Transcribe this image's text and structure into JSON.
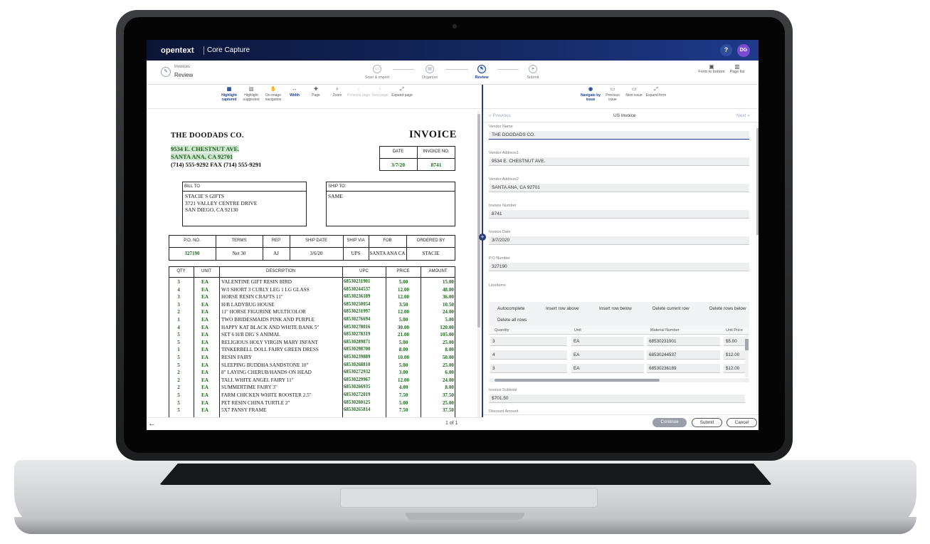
{
  "app": {
    "brand": "opentext",
    "product": "Core Capture",
    "help_glyph": "?",
    "user_initials": "DG"
  },
  "breadcrumb": {
    "parent": "Invoices",
    "current": "Review"
  },
  "steps": [
    {
      "label": "Scan & import",
      "icon": "scan-icon"
    },
    {
      "label": "Organize",
      "icon": "organize-icon"
    },
    {
      "label": "Review",
      "icon": "review-icon",
      "active": true
    },
    {
      "label": "Submit",
      "icon": "submit-icon"
    }
  ],
  "top_tools": {
    "form_to_bottom": "Form to bottom",
    "page_list": "Page list"
  },
  "doc_tools": {
    "highlight_captured": "Highlight captured",
    "highlight_suggested": "Highlight suggested",
    "on_image_navigation": "On-image navigation",
    "width": "Width",
    "page": "Page",
    "zoom": "Zoom",
    "previous_page": "Previous page",
    "next_page": "Next page",
    "expand_page": "Expand page"
  },
  "form_tools": {
    "navigate_by_issue": "Navigate by issue",
    "previous_issue": "Previous issue",
    "next_issue": "Next issue",
    "expand_form": "Expand form"
  },
  "invoice_doc": {
    "company": "THE DOODADS CO.",
    "title": "INVOICE",
    "address1": "9534 E. CHESTNUT AVE.",
    "address2": "SANTA ANA, CA 92701",
    "phone": "(714) 555-9292  FAX (714) 555-9291",
    "date_label": "DATE",
    "invoice_no_label": "INVOICE NO.",
    "date": "3/7/20",
    "invoice_no": "8741",
    "bill_to_label": "BILL TO",
    "bill_to_lines": [
      "STACIE`S GIFTS",
      "3721 VALLEY CENTRE DRIVE",
      "SAN DIEGO, CA  92130"
    ],
    "ship_to_label": "SHIP TO:",
    "ship_to": "SAME",
    "order_headers": [
      "P.O. NO.",
      "TERMS",
      "REP",
      "SHIP DATE",
      "SHIP VIA",
      "FOB",
      "ORDERED BY"
    ],
    "order_values": [
      "327190",
      "Net 30",
      "AJ",
      "3/6/20",
      "UPS",
      "SANTA ANA CA",
      "STACIE"
    ],
    "line_headers": [
      "QTY",
      "UNIT",
      "DESCRIPTION",
      "UPC",
      "PRICE",
      "AMOUNT"
    ],
    "lines": [
      {
        "qty": "3",
        "unit": "EA",
        "desc": "VALENTINE GIFT RESIN BIRD",
        "upc": "68530231901",
        "price": "5.00",
        "amount": "15.00"
      },
      {
        "qty": "4",
        "unit": "EA",
        "desc": "W/I SHORT 3 CURLY LEG 1 LG GLASS",
        "upc": "68530244537",
        "price": "12.00",
        "amount": "48.00"
      },
      {
        "qty": "3",
        "unit": "EA",
        "desc": "HORSE RESIN CRAFTS 11\"",
        "upc": "68530236189",
        "price": "12.00",
        "amount": "36.00"
      },
      {
        "qty": "3",
        "unit": "EA",
        "desc": "H/B LADYBUG HOUSE",
        "upc": "68530250054",
        "price": "3.50",
        "amount": "10.50"
      },
      {
        "qty": "2",
        "unit": "EA",
        "desc": "11\" HORSE FIGURINE MULTICOLOR",
        "upc": "68530231997",
        "price": "12.00",
        "amount": "24.00"
      },
      {
        "qty": "1",
        "unit": "EA",
        "desc": "TWO BRIDESMAIDS PINK AND PURPLE",
        "upc": "68530276694",
        "price": "5.00",
        "amount": "5.00"
      },
      {
        "qty": "4",
        "unit": "EA",
        "desc": "HAPPY KAT BLACK AND WHITE BANK  5\"",
        "upc": "68530278016",
        "price": "30.00",
        "amount": "120.00"
      },
      {
        "qty": "5",
        "unit": "EA",
        "desc": "SET 6 H/B DIG`S ANIMAL",
        "upc": "68530278319",
        "price": "21.00",
        "amount": "105.00"
      },
      {
        "qty": "5",
        "unit": "EA",
        "desc": "RELIGIOUS HOLY VIRGIN MARY INFANT",
        "upc": "68530289871",
        "price": "5.00",
        "amount": "25.00"
      },
      {
        "qty": "1",
        "unit": "EA",
        "desc": "TINKERBELL DOLL FAIRY GREEN DRESS",
        "upc": "68530298700",
        "price": "8.00",
        "amount": "8.00"
      },
      {
        "qty": "5",
        "unit": "EA",
        "desc": "RESIN FAIRY",
        "upc": "68530239889",
        "price": "10.00",
        "amount": "50.00"
      },
      {
        "qty": "5",
        "unit": "EA",
        "desc": "SLEEPING BUDDHA SANDSTONE 10\"",
        "upc": "68530268810",
        "price": "5.00",
        "amount": "25.00"
      },
      {
        "qty": "2",
        "unit": "EA",
        "desc": "8\" LAYING CHERUB/HANDS ON HEAD",
        "upc": "68530272932",
        "price": "3.00",
        "amount": "6.00"
      },
      {
        "qty": "2",
        "unit": "EA",
        "desc": "TALL WHITE ANGEL FAIRY 11\"",
        "upc": "68530229967",
        "price": "12.00",
        "amount": "24.00"
      },
      {
        "qty": "2",
        "unit": "EA",
        "desc": "SUMMERTIME FAIRY 3\"",
        "upc": "68530266935",
        "price": "4.00",
        "amount": "8.00"
      },
      {
        "qty": "5",
        "unit": "EA",
        "desc": "FARM CHICKEN WHITE ROOSTER 2.5\"",
        "upc": "68530272019",
        "price": "7.50",
        "amount": "37.50"
      },
      {
        "qty": "5",
        "unit": "EA",
        "desc": "PET RESIN CHINA TURTLE 2\"",
        "upc": "68530260125",
        "price": "5.00",
        "amount": "25.00"
      },
      {
        "qty": "5",
        "unit": "EA",
        "desc": "5X7 PANSY FRAME",
        "upc": "68530265814",
        "price": "7.50",
        "amount": "37.50"
      }
    ]
  },
  "pager": {
    "text": "1 of 1"
  },
  "form": {
    "nav_prev": "« Previous",
    "title": "US Invoice",
    "nav_next": "Next »",
    "fields": [
      {
        "label": "Vendor Name",
        "value": "THE DOODADS CO."
      },
      {
        "label": "Vendor Address1",
        "value": "9534 E. CHESTNUT AVE."
      },
      {
        "label": "Vendor Address2",
        "value": "SANTA ANA, CA 92701"
      },
      {
        "label": "Invoice Number",
        "value": "8741"
      },
      {
        "label": "Invoice Date",
        "value": "3/7/2020"
      },
      {
        "label": "P.O Number",
        "value": "327190"
      }
    ],
    "lineitems_label": "LineItems",
    "grid_actions": [
      "Autocomplete",
      "Insert row above",
      "Insert row below",
      "Delete current row",
      "Delete rows below",
      "Delete all rows"
    ],
    "grid_headers": [
      "Quantity",
      "Unit",
      "Material Number",
      "Unit Price"
    ],
    "grid_rows": [
      [
        "3",
        "EA",
        "68530231901",
        "$5.00"
      ],
      [
        "4",
        "EA",
        "68530244537",
        "$12.00"
      ],
      [
        "3",
        "EA",
        "68530236189",
        "$12.00"
      ]
    ],
    "subtotal_label": "Invoice Subtotal",
    "subtotal_value": "$701.50",
    "discount_label": "Discount Amount"
  },
  "buttons": {
    "continue": "Continue",
    "submit": "Submit",
    "cancel": "Cancel"
  }
}
